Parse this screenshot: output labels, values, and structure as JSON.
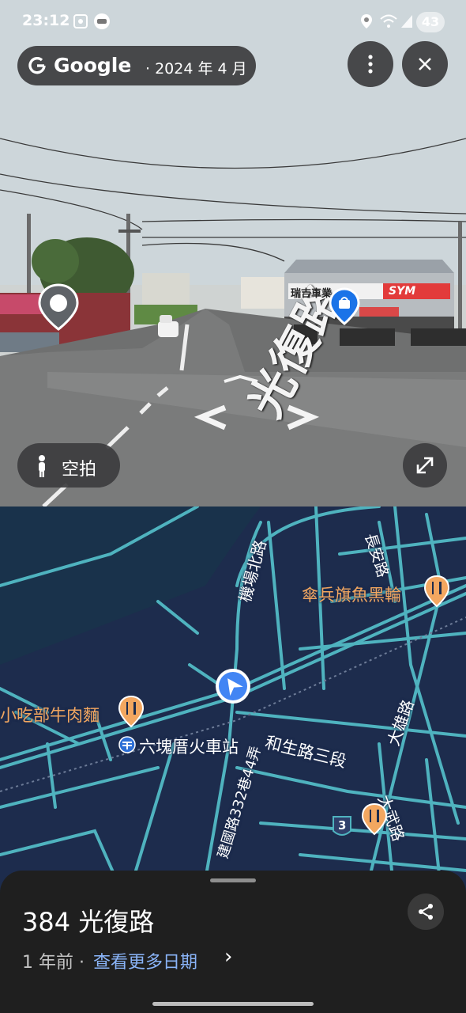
{
  "status_bar": {
    "time": "23:12",
    "battery": "43"
  },
  "header": {
    "brand": "Google",
    "date": "· 2024 年 4 月"
  },
  "photo": {
    "shop_sign": "瑞吉車業",
    "brand_sign": "SYM",
    "road_text": "光復路"
  },
  "aerial_button": {
    "label": "空拍"
  },
  "map": {
    "roads": {
      "changan": "長安路",
      "airport_north": "機場北路",
      "hesheng": "和生路三段",
      "dayong": "大雄路",
      "dawu": "大武路",
      "jianguo": "建國路332巷44弄"
    },
    "pois": {
      "umbrella_fish": "傘兵旗魚黑輪",
      "beef_noodle": "小吃部牛肉麵",
      "station": "六塊厝火車站"
    },
    "route_number": "3"
  },
  "sheet": {
    "title": "384 光復路",
    "age": "1 年前 ·",
    "more_dates": "查看更多日期",
    "chevron": "›"
  },
  "colors": {
    "map_bg": "#1d2c4d",
    "road": "#4fb3bf",
    "poi": "#f3a760",
    "link": "#8ab4f8",
    "location": "#4285f4"
  }
}
